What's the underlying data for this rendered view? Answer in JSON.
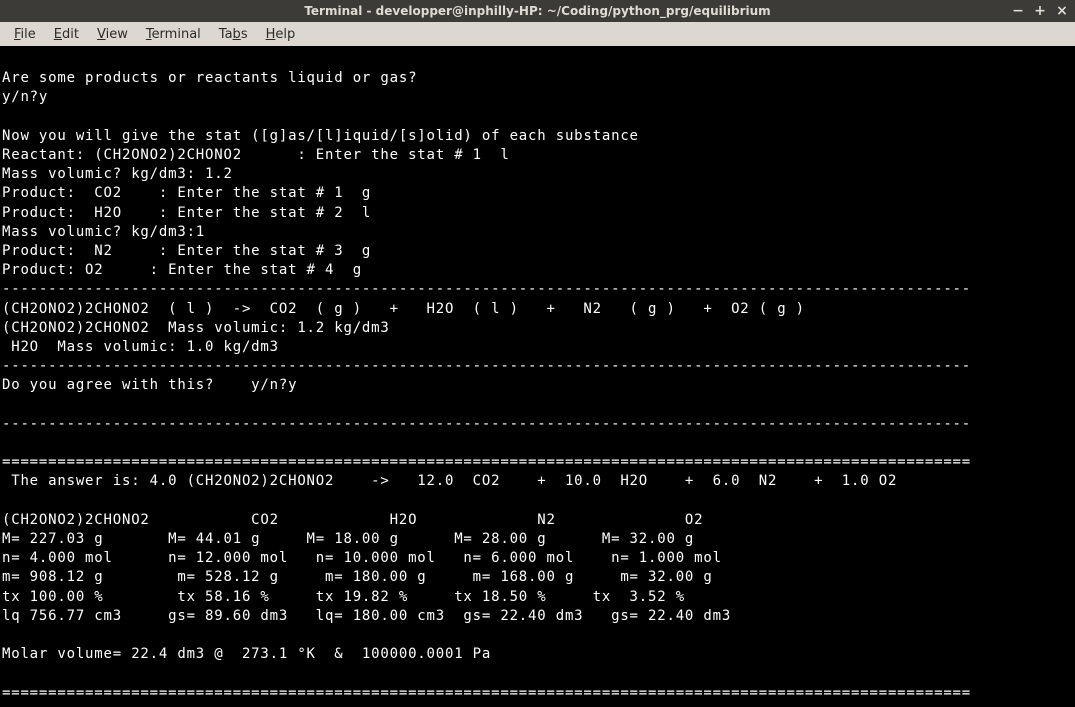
{
  "window": {
    "title": "Terminal - developper@inphilly-HP: ~/Coding/python_prg/equilibrium",
    "controls": {
      "minimize": "−",
      "maximize": "+",
      "close": "×"
    }
  },
  "menu": {
    "file": "File",
    "edit": "Edit",
    "view": "View",
    "terminal": "Terminal",
    "tabs": "Tabs",
    "help": "Help"
  },
  "lines": {
    "l0": "",
    "l1": "Are some products or reactants liquid or gas?",
    "l2": "y/n?y",
    "l3": "",
    "l4": "Now you will give the stat ([g]as/[l]iquid/[s]olid) of each substance",
    "l5": "Reactant: (CH2ONO2)2CHONO2      : Enter the stat # 1  l",
    "l6": "Mass volumic? kg/dm3: 1.2",
    "l7": "Product:  CO2    : Enter the stat # 1  g",
    "l8": "Product:  H2O    : Enter the stat # 2  l",
    "l9": "Mass volumic? kg/dm3:1",
    "l10": "Product:  N2     : Enter the stat # 3  g",
    "l11": "Product: O2     : Enter the stat # 4  g",
    "l12": "---------------------------------------------------------------------------------------------------------",
    "l13": "(CH2ONO2)2CHONO2  ( l )  ->  CO2  ( g )   +   H2O  ( l )   +   N2   ( g )   +  O2 ( g )",
    "l14": "(CH2ONO2)2CHONO2  Mass volumic: 1.2 kg/dm3",
    "l15": " H2O  Mass volumic: 1.0 kg/dm3",
    "l16": "---------------------------------------------------------------------------------------------------------",
    "l17": "Do you agree with this?    y/n?y",
    "l18": "",
    "l19": "---------------------------------------------------------------------------------------------------------",
    "l20": "",
    "l21": "=========================================================================================================",
    "l22": " The answer is: 4.0 (CH2ONO2)2CHONO2    ->   12.0  CO2    +  10.0  H2O    +  6.0  N2    +  1.0 O2",
    "l23": "",
    "l24": "(CH2ONO2)2CHONO2           CO2            H2O             N2              O2",
    "l25": "M= 227.03 g       M= 44.01 g     M= 18.00 g      M= 28.00 g      M= 32.00 g",
    "l26": "n= 4.000 mol      n= 12.000 mol   n= 10.000 mol   n= 6.000 mol    n= 1.000 mol",
    "l27": "m= 908.12 g        m= 528.12 g     m= 180.00 g     m= 168.00 g     m= 32.00 g",
    "l28": "tx 100.00 %        tx 58.16 %     tx 19.82 %     tx 18.50 %     tx  3.52 %",
    "l29": "lq 756.77 cm3     gs= 89.60 dm3   lq= 180.00 cm3  gs= 22.40 dm3   gs= 22.40 dm3",
    "l30": "",
    "l31": "Molar volume= 22.4 dm3 @  273.1 °K  &  100000.0001 Pa",
    "l32": "",
    "l33": "========================================================================================================="
  }
}
